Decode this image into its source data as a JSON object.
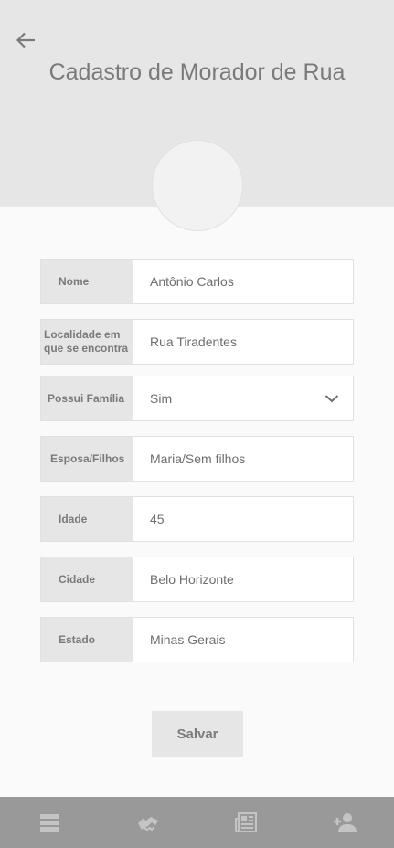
{
  "header": {
    "title": "Cadastro de Morador de Rua",
    "back_icon": "arrow-left-icon"
  },
  "form": {
    "fields": [
      {
        "label": "Nome",
        "value": "Antônio Carlos"
      },
      {
        "label": "Localidade em que se encontra",
        "value": "Rua Tiradentes"
      },
      {
        "label": "Possui Família",
        "value": "Sim"
      },
      {
        "label": "Esposa/Filhos",
        "value": "Maria/Sem filhos"
      },
      {
        "label": "Idade",
        "value": "45"
      },
      {
        "label": "Cidade",
        "value": "Belo Horizonte"
      },
      {
        "label": "Estado",
        "value": "Minas Gerais"
      }
    ]
  },
  "actions": {
    "save_label": "Salvar"
  },
  "bottom_nav": {
    "items": [
      {
        "icon": "list-view-icon"
      },
      {
        "icon": "handshake-icon"
      },
      {
        "icon": "newspaper-icon"
      },
      {
        "icon": "add-person-icon"
      }
    ]
  },
  "colors": {
    "header_bg": "#e6e6e6",
    "page_bg": "#fafafa",
    "nav_bg": "#999999",
    "text_gray": "#7a7a7a"
  }
}
